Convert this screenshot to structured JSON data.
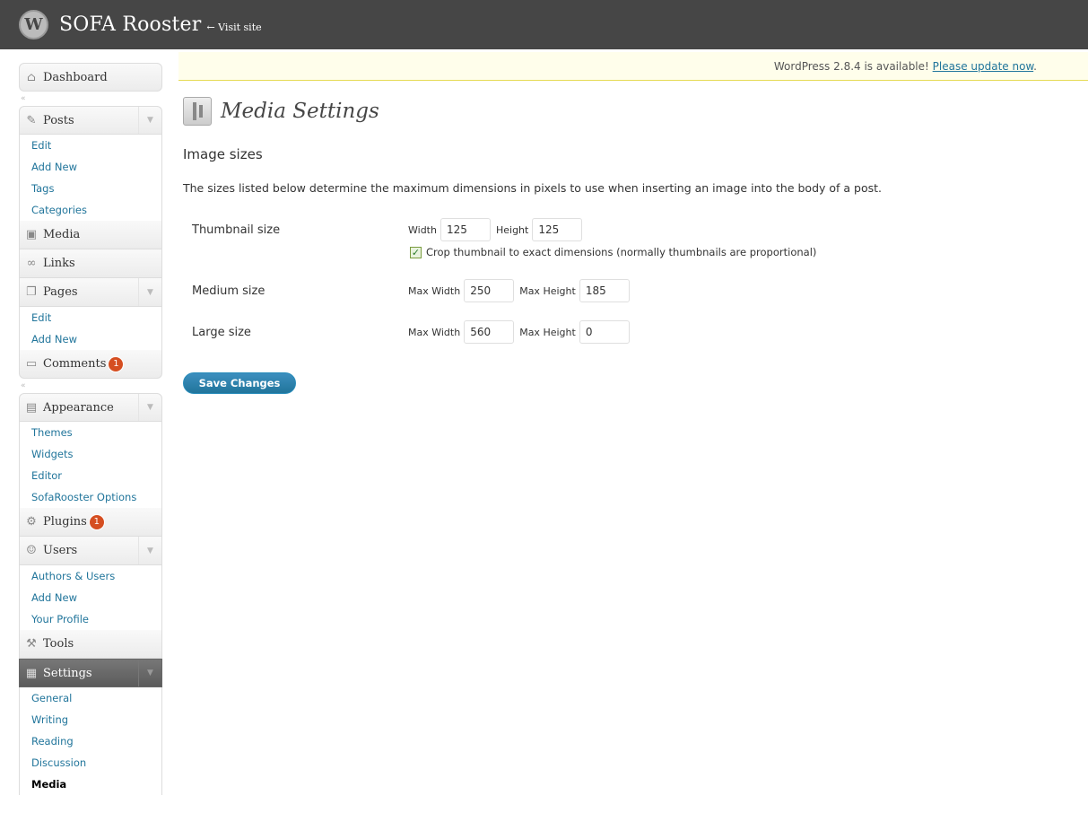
{
  "header": {
    "logo_glyph": "W",
    "site_title": "SOFA Rooster",
    "visit_site": "← Visit site"
  },
  "update_nag": {
    "text": "WordPress 2.8.4 is available! ",
    "link": "Please update now",
    "suffix": "."
  },
  "sidebar": {
    "dashboard": "Dashboard",
    "posts": {
      "label": "Posts",
      "items": [
        "Edit",
        "Add New",
        "Tags",
        "Categories"
      ]
    },
    "media": "Media",
    "links": "Links",
    "pages": {
      "label": "Pages",
      "items": [
        "Edit",
        "Add New"
      ]
    },
    "comments": {
      "label": "Comments",
      "badge": "1"
    },
    "appearance": {
      "label": "Appearance",
      "items": [
        "Themes",
        "Widgets",
        "Editor",
        "SofaRooster Options"
      ]
    },
    "plugins": {
      "label": "Plugins",
      "badge": "1"
    },
    "users": {
      "label": "Users",
      "items": [
        "Authors & Users",
        "Add New",
        "Your Profile"
      ]
    },
    "tools": "Tools",
    "settings": {
      "label": "Settings",
      "items": [
        "General",
        "Writing",
        "Reading",
        "Discussion",
        "Media"
      ]
    }
  },
  "main": {
    "page_title": "Media Settings",
    "section_title": "Image sizes",
    "description": "The sizes listed below determine the maximum dimensions in pixels to use when inserting an image into the body of a post.",
    "thumbnail": {
      "label": "Thumbnail size",
      "width_label": "Width",
      "width_value": "125",
      "height_label": "Height",
      "height_value": "125",
      "crop_label": "Crop thumbnail to exact dimensions (normally thumbnails are proportional)",
      "crop_checked": true
    },
    "medium": {
      "label": "Medium size",
      "width_label": "Max Width",
      "width_value": "250",
      "height_label": "Max Height",
      "height_value": "185"
    },
    "large": {
      "label": "Large size",
      "width_label": "Max Width",
      "width_value": "560",
      "height_label": "Max Height",
      "height_value": "0"
    },
    "save_label": "Save Changes"
  }
}
